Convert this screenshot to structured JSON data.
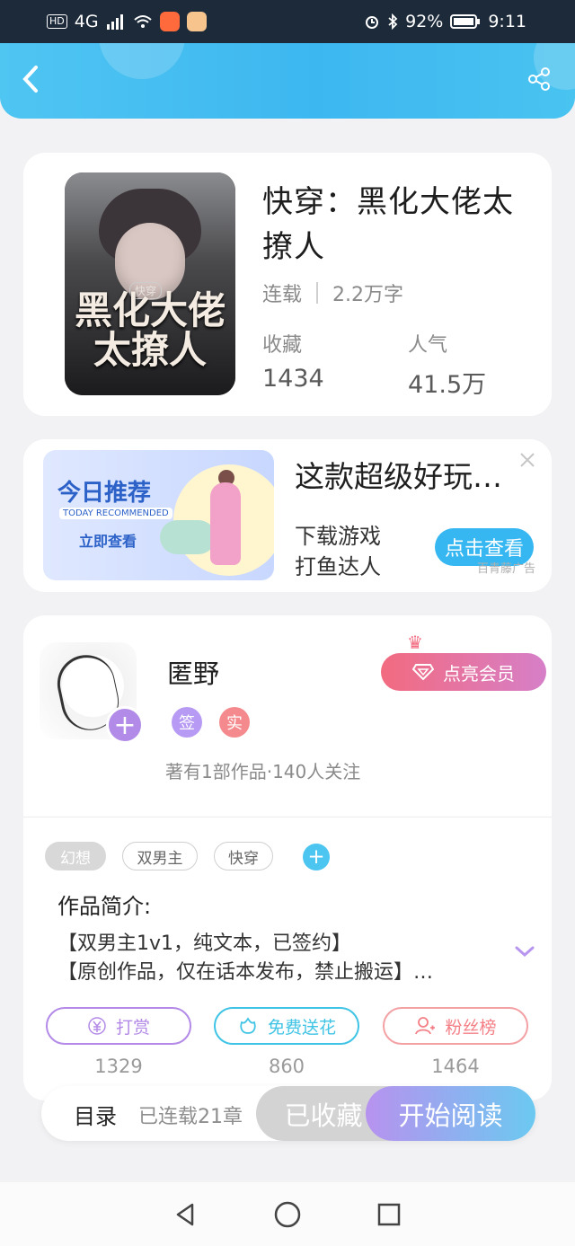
{
  "status_bar": {
    "network": "HD",
    "signal": "4G",
    "battery": "92%",
    "time": "9:11"
  },
  "book": {
    "title": "快穿：黑化大佬太撩人",
    "status": "连载",
    "word_count": "2.2万字",
    "collect_label": "收藏",
    "collect_value": "1434",
    "popularity_label": "人气",
    "popularity_value": "41.5万",
    "cover_small_text": "快穿",
    "cover_title": "黑化大佬太撩人"
  },
  "ad": {
    "image_title": "今日推荐",
    "image_subtitle": "TODAY RECOMMENDED",
    "image_cta": "立即查看",
    "headline": "这款超级好玩…",
    "line1": "下载游戏",
    "line2": "打鱼达人",
    "button": "点击查看",
    "source": "百青藤广告"
  },
  "author": {
    "name": "匿野",
    "badge_sign": "签",
    "badge_real": "实",
    "meta": "著有1部作品·140人关注",
    "vip_button": "点亮会员"
  },
  "tags": [
    "幻想",
    "双男主",
    "快穿"
  ],
  "intro": {
    "title": "作品简介:",
    "text_line1": "【双男主1v1，纯文本，已签约】",
    "text_line2": "【原创作品，仅在话本发布，禁止搬运】…"
  },
  "actions": [
    {
      "label": "打赏",
      "count": "1329"
    },
    {
      "label": "免费送花",
      "count": "860"
    },
    {
      "label": "粉丝榜",
      "count": "1464"
    }
  ],
  "bottom_bar": {
    "toc": "目录",
    "chapters": "已连载21章",
    "collected": "已收藏",
    "start_reading": "开始阅读"
  },
  "colors": {
    "header": "#3db7f0",
    "accent_purple": "#b18be7",
    "accent_blue": "#36b7f2",
    "vip_pink": "#f26b80"
  },
  "icons": {
    "back": "chevron-left-icon",
    "share": "share-icon",
    "close": "close-icon",
    "expand": "chevron-down-icon"
  }
}
